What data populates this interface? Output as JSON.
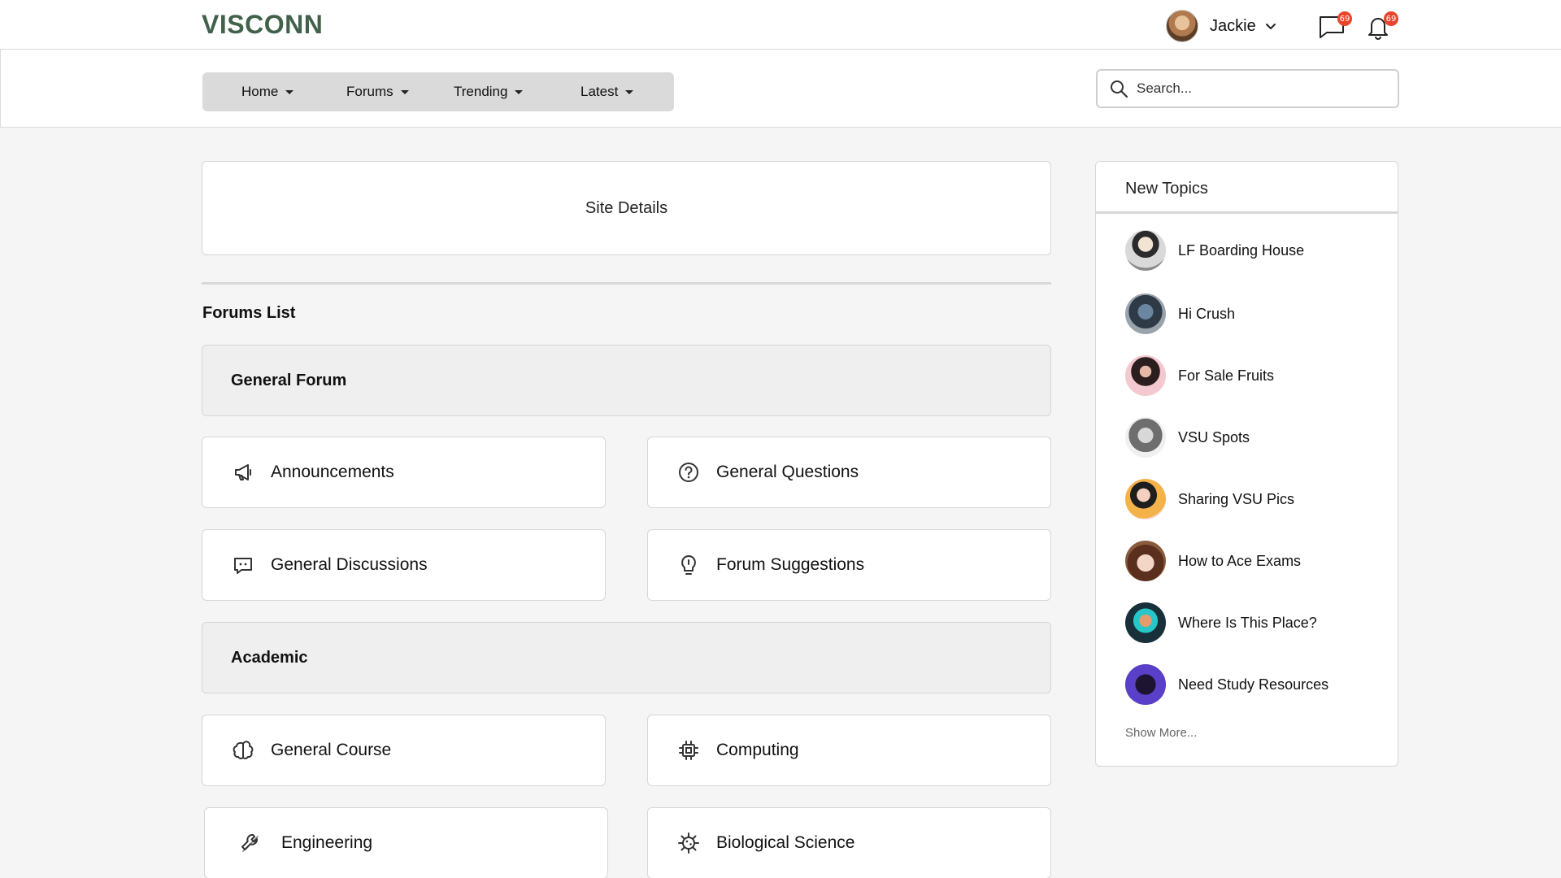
{
  "app": {
    "logo": "VISCONN"
  },
  "user": {
    "name": "Jackie"
  },
  "header_icons": {
    "messages": {
      "icon": "chat-icon",
      "badge": "69"
    },
    "notifications": {
      "icon": "bell-icon",
      "badge": "69"
    }
  },
  "nav": {
    "items": [
      {
        "label": "Home"
      },
      {
        "label": "Forums"
      },
      {
        "label": "Trending"
      },
      {
        "label": "Latest"
      }
    ]
  },
  "search": {
    "placeholder": "Search..."
  },
  "main": {
    "site_details": "Site Details",
    "forums_title": "Forums List",
    "sections": [
      {
        "title": "General Forum",
        "forums": [
          {
            "label": "Announcements",
            "icon": "megaphone-icon"
          },
          {
            "label": "General Questions",
            "icon": "question-circle-icon"
          },
          {
            "label": "General Discussions",
            "icon": "message-square-icon"
          },
          {
            "label": "Forum Suggestions",
            "icon": "lightbulb-icon"
          }
        ]
      },
      {
        "title": "Academic",
        "forums": [
          {
            "label": "General Course",
            "icon": "brain-icon"
          },
          {
            "label": "Computing",
            "icon": "cpu-icon"
          },
          {
            "label": "Engineering",
            "icon": "wrench-icon"
          },
          {
            "label": "Biological Science",
            "icon": "virus-icon"
          }
        ]
      }
    ]
  },
  "sidebar": {
    "title": "New Topics",
    "topics": [
      {
        "label": "LF Boarding House"
      },
      {
        "label": "Hi Crush"
      },
      {
        "label": "For Sale Fruits"
      },
      {
        "label": "VSU Spots"
      },
      {
        "label": "Sharing VSU Pics"
      },
      {
        "label": "How to Ace Exams"
      },
      {
        "label": "Where Is This Place?"
      },
      {
        "label": "Need Study Resources"
      }
    ],
    "show_more": "Show More..."
  },
  "colors": {
    "brand": "#41614a",
    "badge": "#e8452c",
    "page_bg": "#f5f5f5",
    "nav_pill": "#dadada"
  }
}
